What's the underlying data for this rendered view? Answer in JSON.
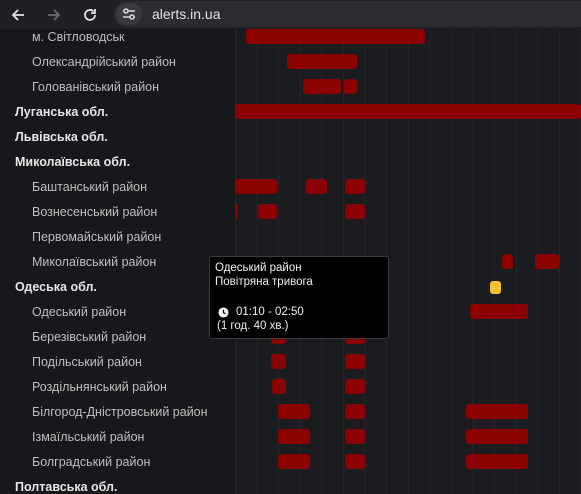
{
  "browser": {
    "back_icon": "arrow-left-icon",
    "forward_icon": "arrow-right-icon",
    "reload_icon": "reload-icon",
    "site_info_icon": "tune-icon",
    "url": "alerts.in.ua"
  },
  "colors": {
    "alert_bar": "#8b0000",
    "partial_alert": "#f2c233",
    "background": "#17181b"
  },
  "rows": [
    {
      "label": "м. Світловодськ",
      "level": "district",
      "bars": [
        {
          "status": "alert"
        }
      ]
    },
    {
      "label": "Олександрійський район",
      "level": "district",
      "bars": [
        {
          "status": "alert"
        }
      ]
    },
    {
      "label": "Голованівський район",
      "level": "district",
      "bars": [
        {
          "status": "alert"
        },
        {
          "status": "alert"
        }
      ]
    },
    {
      "label": "Луганська обл.",
      "level": "oblast",
      "bars": [
        {
          "status": "alert"
        }
      ]
    },
    {
      "label": "Львівська обл.",
      "level": "oblast",
      "bars": []
    },
    {
      "label": "Миколаївська обл.",
      "level": "oblast",
      "bars": []
    },
    {
      "label": "Баштанський район",
      "level": "district",
      "bars": [
        {
          "status": "alert"
        },
        {
          "status": "alert"
        },
        {
          "status": "alert"
        }
      ]
    },
    {
      "label": "Вознесенський район",
      "level": "district",
      "bars": [
        {
          "status": "alert"
        },
        {
          "status": "alert"
        },
        {
          "status": "alert"
        }
      ]
    },
    {
      "label": "Первомайський район",
      "level": "district",
      "bars": []
    },
    {
      "label": "Миколаївський район",
      "level": "district",
      "bars": [
        {
          "status": "alert"
        },
        {
          "status": "alert"
        }
      ]
    },
    {
      "label": "Одеська обл.",
      "level": "oblast",
      "bars": [
        {
          "status": "partial"
        }
      ]
    },
    {
      "label": "Одеський район",
      "level": "district",
      "bars": [
        {
          "status": "alert"
        },
        {
          "status": "alert"
        },
        {
          "status": "alert"
        }
      ]
    },
    {
      "label": "Березівський район",
      "level": "district",
      "bars": [
        {
          "status": "alert"
        },
        {
          "status": "alert"
        }
      ]
    },
    {
      "label": "Подільський район",
      "level": "district",
      "bars": [
        {
          "status": "alert"
        },
        {
          "status": "alert"
        }
      ]
    },
    {
      "label": "Роздільнянський район",
      "level": "district",
      "bars": [
        {
          "status": "alert"
        },
        {
          "status": "alert"
        }
      ]
    },
    {
      "label": "Білгород-Дністровський район",
      "level": "district",
      "bars": [
        {
          "status": "alert"
        },
        {
          "status": "alert"
        },
        {
          "status": "alert"
        }
      ]
    },
    {
      "label": "Ізмаїльський район",
      "level": "district",
      "bars": [
        {
          "status": "alert"
        },
        {
          "status": "alert"
        },
        {
          "status": "alert"
        }
      ]
    },
    {
      "label": "Болградський район",
      "level": "district",
      "bars": [
        {
          "status": "alert"
        },
        {
          "status": "alert"
        },
        {
          "status": "alert"
        }
      ]
    },
    {
      "label": "Полтавська обл.",
      "level": "oblast",
      "bars": []
    }
  ],
  "tooltip": {
    "region": "Одеський район",
    "alert_type": "Повітряна тривога",
    "clock_icon": "clock-icon",
    "time_range": "01:10 - 02:50",
    "duration": "(1 год. 40 хв.)"
  }
}
